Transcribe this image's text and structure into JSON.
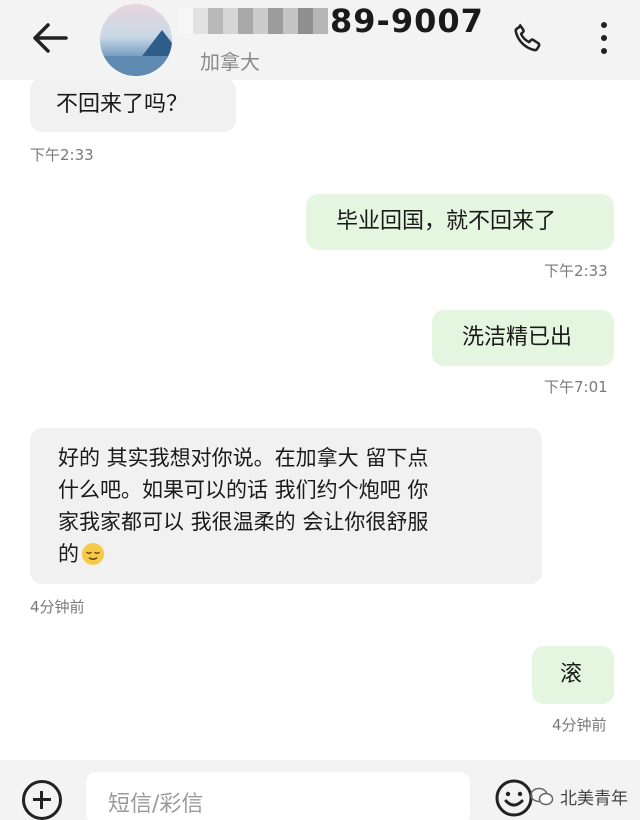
{
  "header": {
    "phone_suffix": "89-9007",
    "location": "加拿大"
  },
  "messages": [
    {
      "dir": "in",
      "text": "不回来了吗？",
      "time": "下午2:33"
    },
    {
      "dir": "out",
      "text": "毕业回国，就不回来了",
      "time": "下午2:33"
    },
    {
      "dir": "out",
      "text": "洗洁精已出",
      "time": "下午7:01"
    },
    {
      "dir": "in",
      "lines": [
        "好的 其实我想对你说。在加拿大 留下点",
        "什么吧。如果可以的话 我们约个炮吧 你",
        "家我家都可以 我很温柔的 会让你很舒服",
        "的"
      ],
      "emoji": "relieved-face",
      "time": "4分钟前"
    },
    {
      "dir": "out",
      "text": "滚",
      "time": "4分钟前"
    }
  ],
  "composer": {
    "placeholder": "短信/彩信"
  },
  "watermark": {
    "text": "北美青年"
  }
}
